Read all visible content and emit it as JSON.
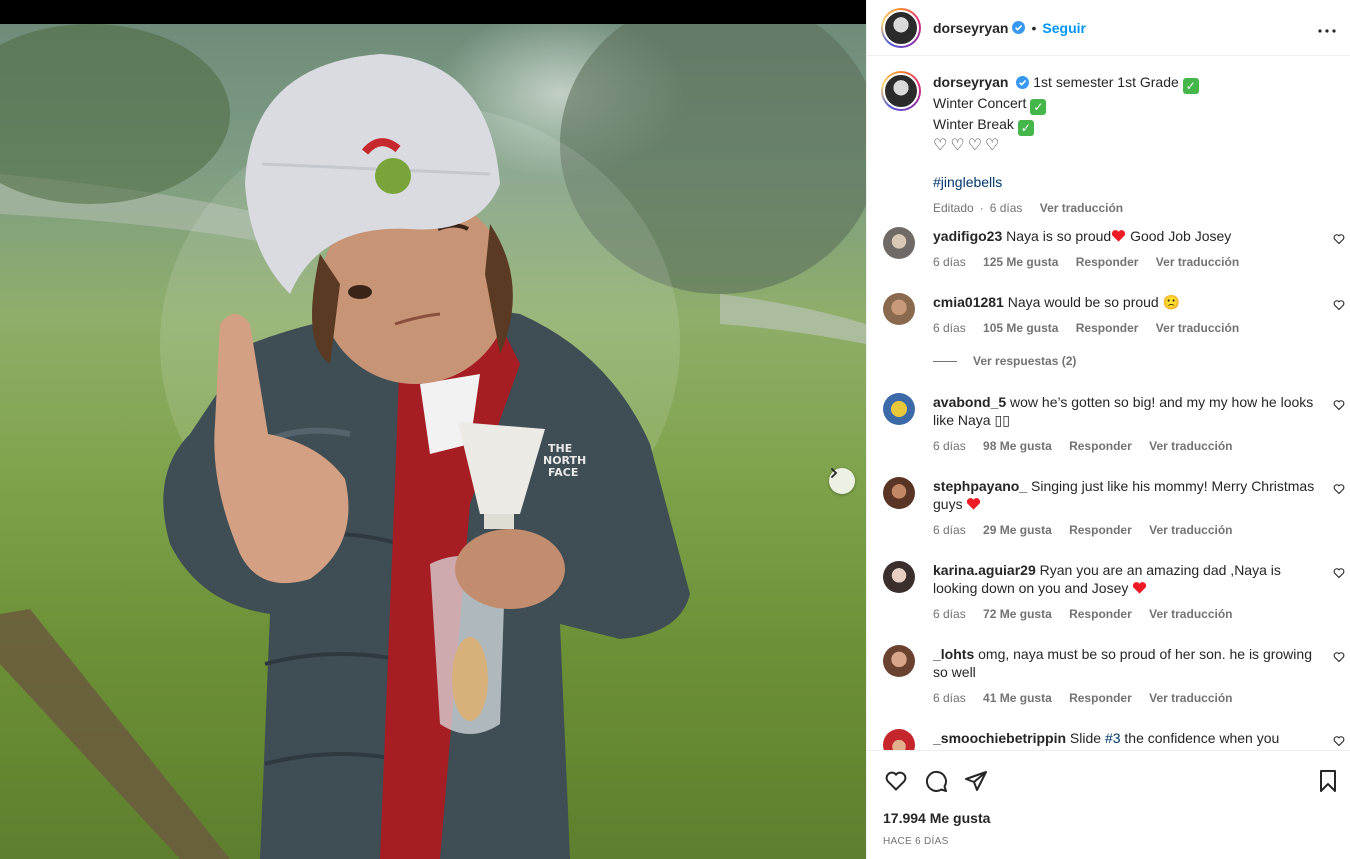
{
  "post": {
    "username": "dorseyryan",
    "dot": "•",
    "follow_label": "Seguir",
    "more_label": "•••"
  },
  "caption": {
    "username": "dorseyryan",
    "line1": "1st semester 1st Grade",
    "line2": "Winter Concert",
    "line3": "Winter Break",
    "check_glyph": "✓",
    "hearts": "♡♡♡♡",
    "hashtag": "#jinglebells",
    "edited": "Editado",
    "time": "6 días",
    "translate": "Ver traducción"
  },
  "comments": [
    {
      "username": "yadifigo23",
      "text": "Naya is so proud",
      "text_after": " Good Job Josey",
      "time": "6 días",
      "likes": "125 Me gusta",
      "reply": "Responder",
      "translate": "Ver traducción"
    },
    {
      "username": "cmia01281",
      "text": "Naya would be so proud",
      "emoji": "🙁",
      "time": "6 días",
      "likes": "105 Me gusta",
      "reply": "Responder",
      "translate": "Ver traducción"
    },
    {
      "username": "avabond_5",
      "text": "wow he’s gotten so big! and my my how he looks like Naya",
      "trailing": "▯▯",
      "time": "6 días",
      "likes": "98 Me gusta",
      "reply": "Responder",
      "translate": "Ver traducción"
    },
    {
      "username": "stephpayano_",
      "text": "Singing just like his mommy! Merry Christmas guys",
      "time": "6 días",
      "likes": "29 Me gusta",
      "reply": "Responder",
      "translate": "Ver traducción"
    },
    {
      "username": "karina.aguiar29",
      "text": "Ryan you are an amazing dad ,Naya is looking down on you and Josey",
      "time": "6 días",
      "likes": "72 Me gusta",
      "reply": "Responder",
      "translate": "Ver traducción"
    },
    {
      "username": "_lohts",
      "text": "omg, naya must be so proud of her son. he is growing so well",
      "time": "6 días",
      "likes": "41 Me gusta",
      "reply": "Responder",
      "translate": "Ver traducción"
    },
    {
      "username": "_smoochiebetrippin",
      "text": "Slide ",
      "hashtag": "#3",
      "text_after": " the confidence when you know"
    }
  ],
  "view_replies": "Ver respuestas (2)",
  "likes_total": "17.994 Me gusta",
  "date_label": "HACE 6 DÍAS",
  "colors": {
    "accent": "#0095f6",
    "verified": "#3897f0",
    "check": "#45b649",
    "heart_red": "#ed1c24"
  }
}
